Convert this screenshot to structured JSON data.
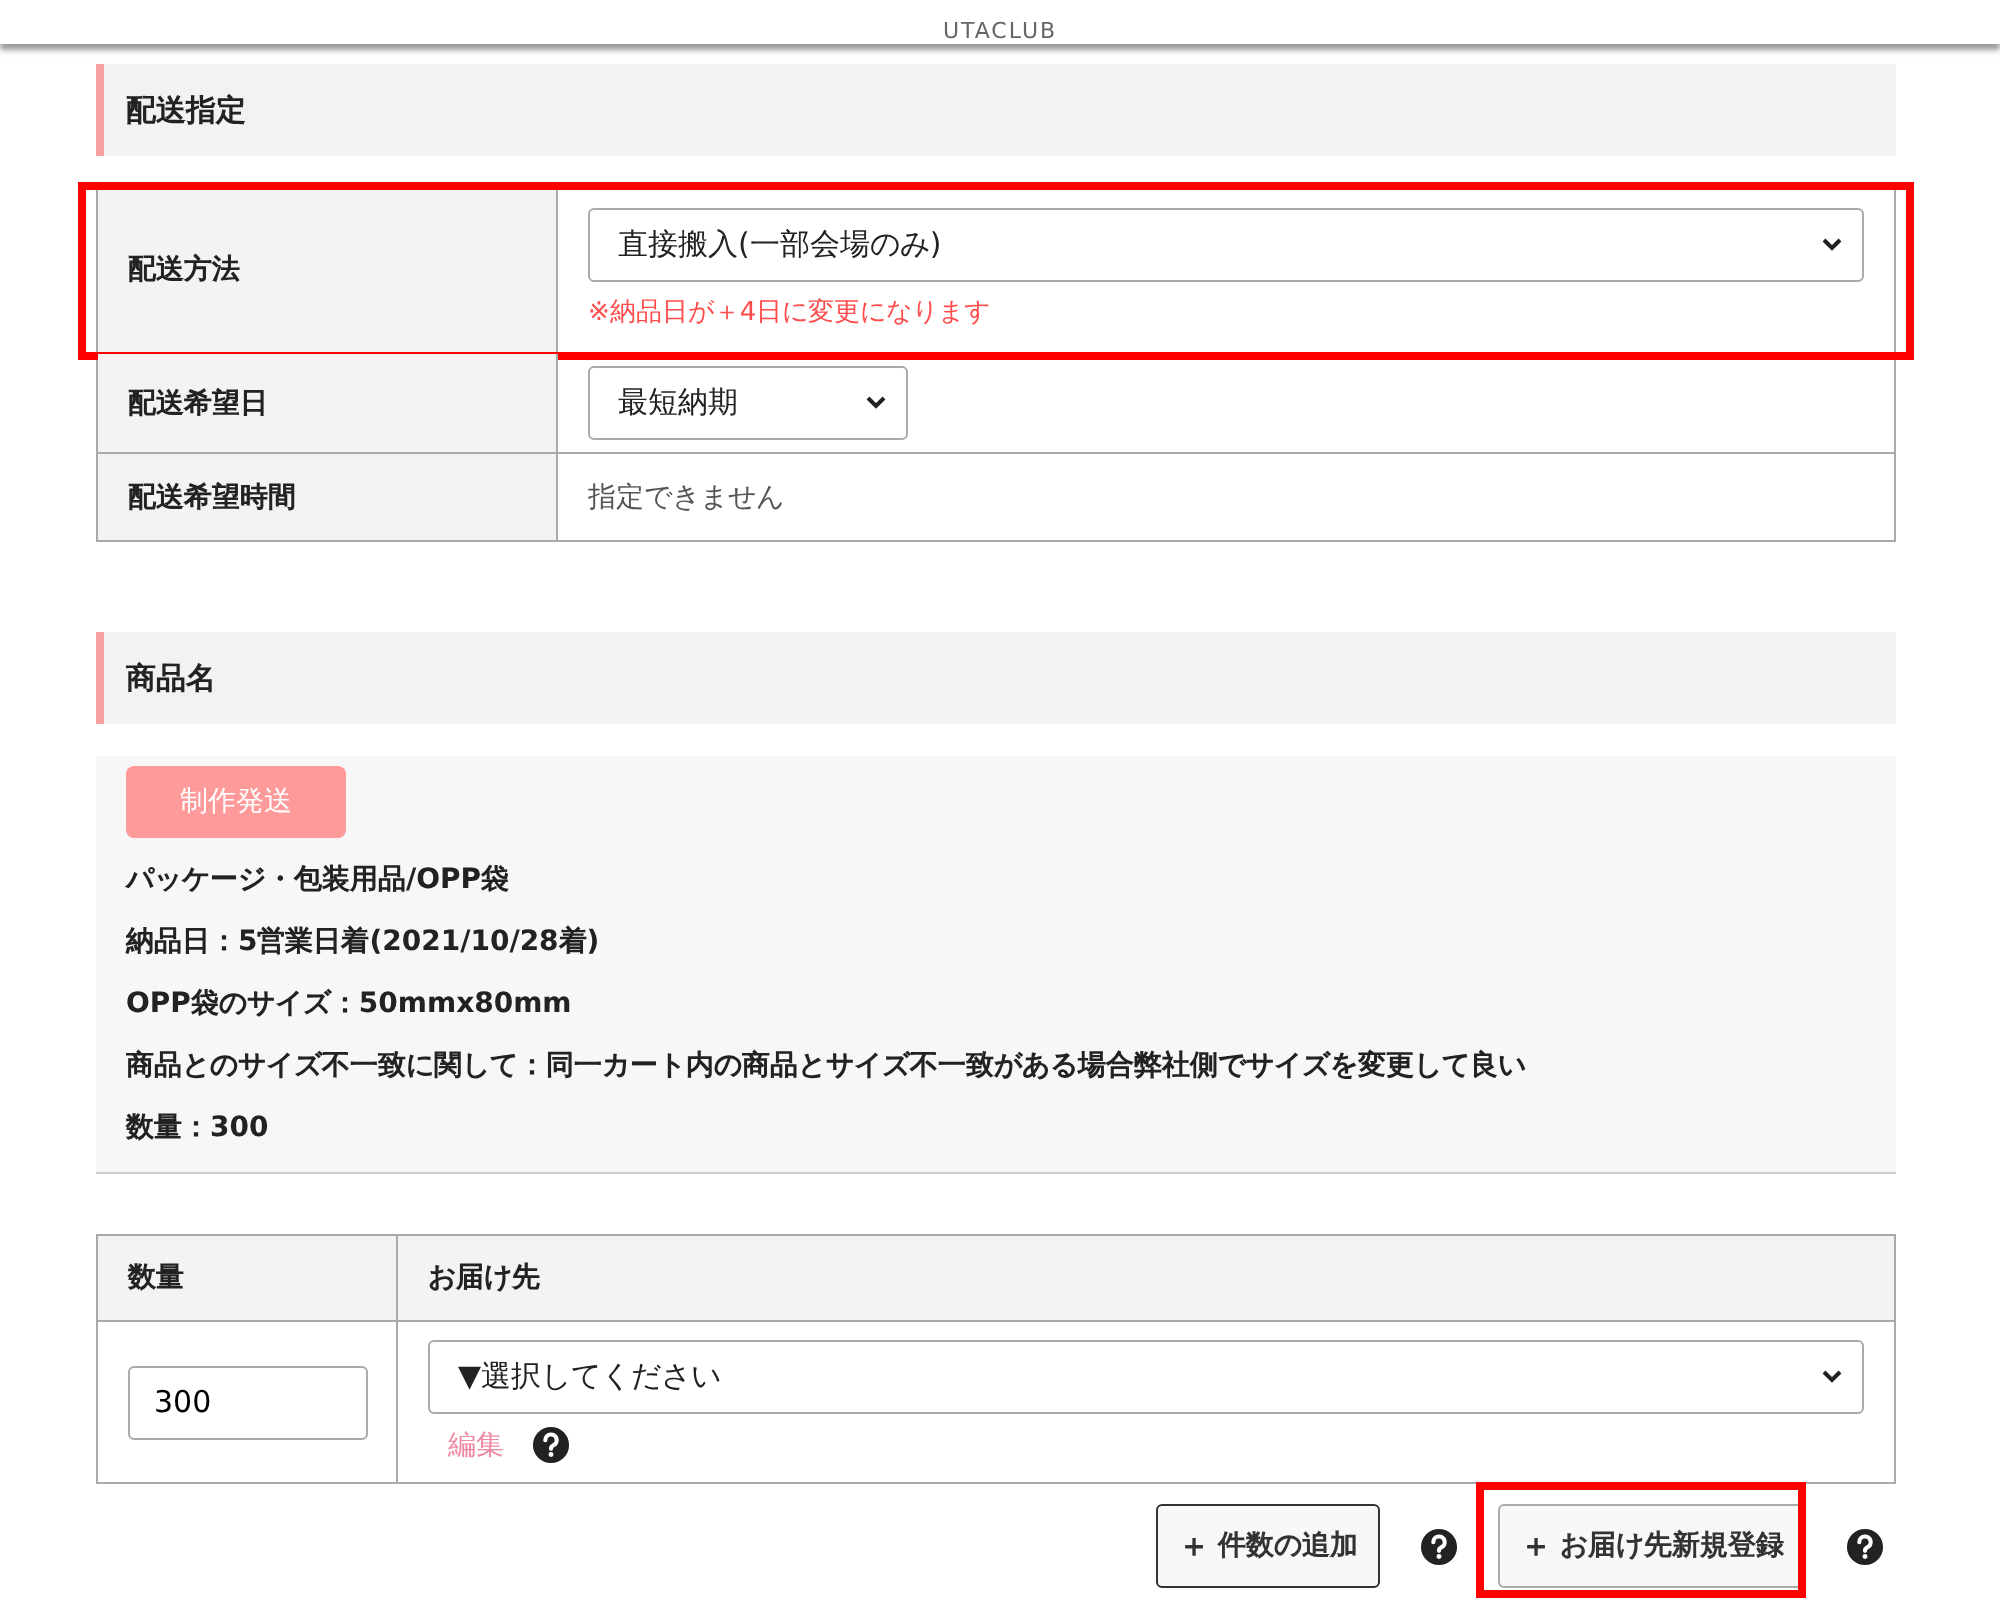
{
  "header": {
    "brand": "UTACLUB"
  },
  "delivery": {
    "heading": "配送指定",
    "rows": [
      {
        "kind": "select",
        "label": "配送方法",
        "value": "直接搬入(一部会場のみ)",
        "note": "※納品日が＋4日に変更になります",
        "highlighted": true
      },
      {
        "kind": "small-select",
        "label": "配送希望日",
        "value": "最短納期",
        "highlighted": false
      },
      {
        "kind": "text",
        "label": "配送希望時間",
        "value": "指定できません",
        "highlighted": false
      }
    ]
  },
  "product": {
    "heading": "商品名",
    "badge": "制作発送",
    "lines": [
      "パッケージ・包装用品/OPP袋",
      "納品日：5営業日着(2021/10/28着)",
      "OPP袋のサイズ：50mmx80mm",
      "商品とのサイズ不一致に関して：同一カート内の商品とサイズ不一致がある場合弊社側でサイズを変更して良い",
      "数量：300"
    ]
  },
  "destinations": {
    "columns": [
      "数量",
      "お届け先"
    ],
    "rows": [
      {
        "quantity": "300",
        "destination": "▼選択してください",
        "edit_link": "編集"
      }
    ]
  },
  "buttons": [
    {
      "icon": "＋",
      "label": "件数の追加",
      "highlighted": false
    },
    {
      "icon": "＋",
      "label": "お届け先新規登録",
      "highlighted": true
    }
  ]
}
